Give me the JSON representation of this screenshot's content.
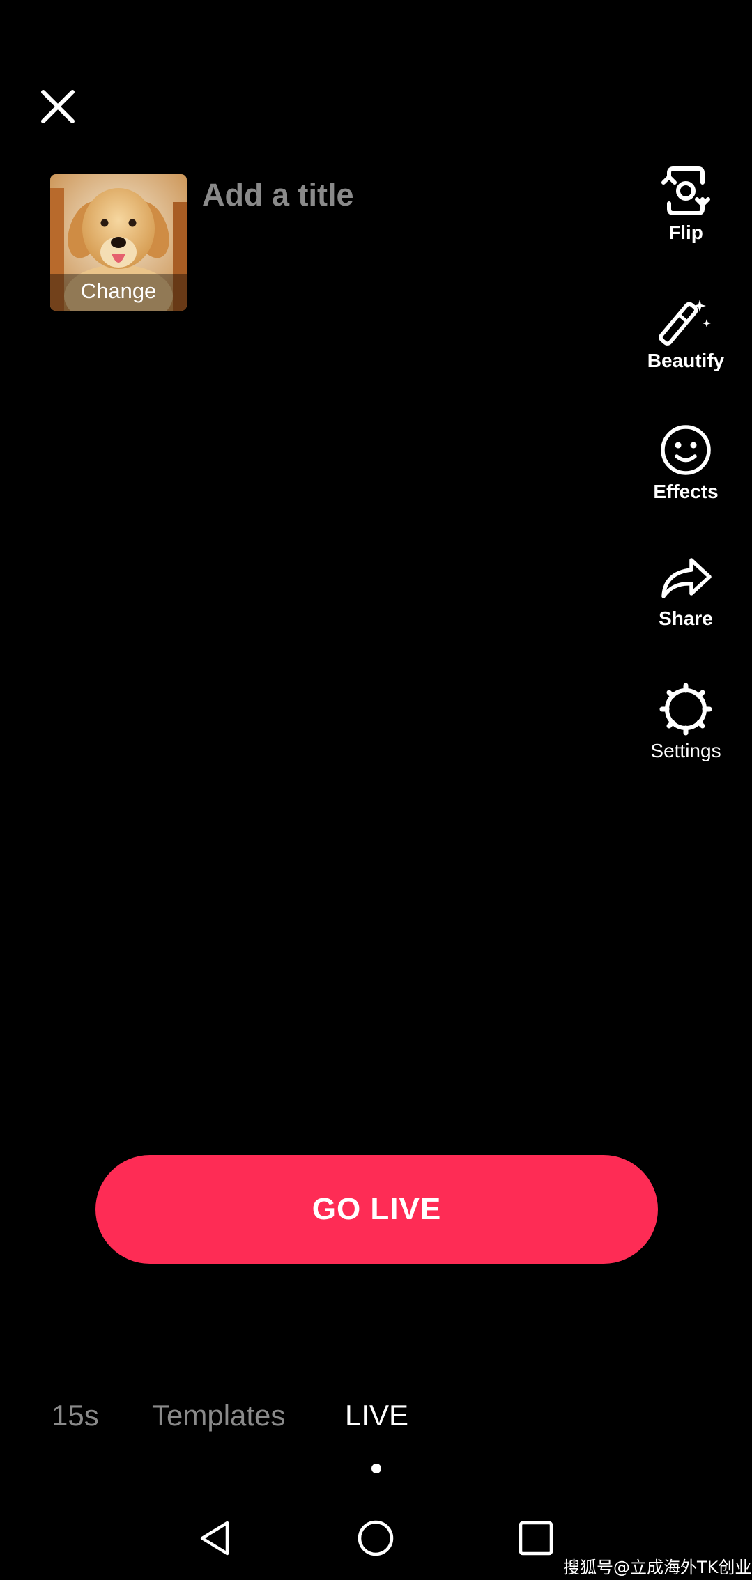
{
  "header": {
    "close_icon": "close-icon",
    "title_placeholder": "Add a title",
    "title_value": ""
  },
  "cover": {
    "image": "golden-retriever-photo",
    "change_label": "Change"
  },
  "tools": [
    {
      "label": "Flip",
      "icon": "flip-camera-icon"
    },
    {
      "label": "Beautify",
      "icon": "magic-wand-icon"
    },
    {
      "label": "Effects",
      "icon": "smiley-face-icon"
    },
    {
      "label": "Share",
      "icon": "share-arrow-icon"
    },
    {
      "label": "Settings",
      "icon": "gear-icon"
    }
  ],
  "go_live_label": "GO LIVE",
  "modes": [
    {
      "label": "15s",
      "active": false
    },
    {
      "label": "Templates",
      "active": false
    },
    {
      "label": "LIVE",
      "active": true
    }
  ],
  "system_nav": [
    "back-icon",
    "home-icon",
    "recents-icon"
  ],
  "watermark": "搜狐号@立成海外TK创业",
  "colors": {
    "accent": "#fe2c55",
    "background": "#000000",
    "inactive_text": "#8a8a8a",
    "active_text": "#ffffff"
  }
}
